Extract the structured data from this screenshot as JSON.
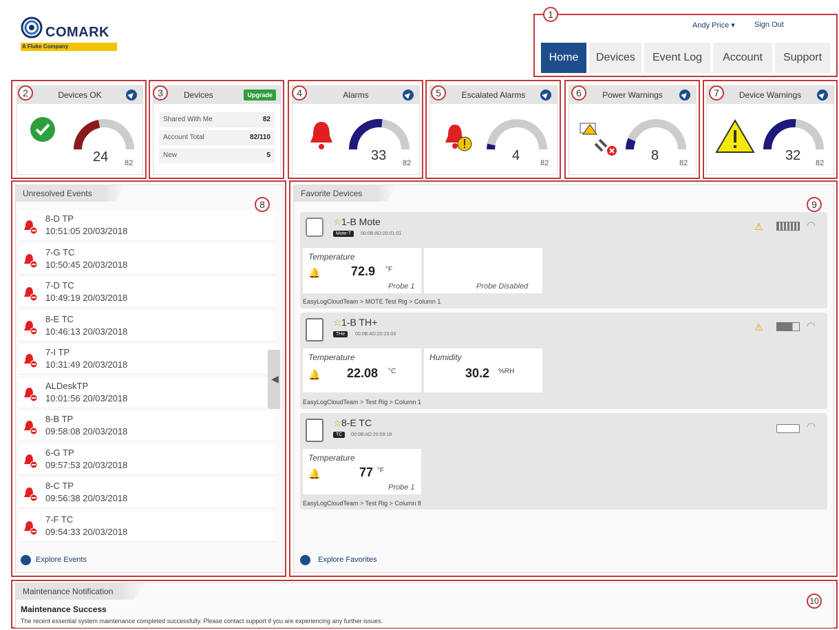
{
  "brand": {
    "name": "COMARK",
    "tagline": "A Fluke Company",
    "color": "#1d2f63",
    "accent": "#f3c300"
  },
  "user": {
    "name": "Andy Price",
    "sign_out": "Sign Out"
  },
  "nav": [
    "Home",
    "Devices",
    "Event Log",
    "Account",
    "Support"
  ],
  "annotations": [
    "1",
    "2",
    "3",
    "4",
    "5",
    "6",
    "7",
    "8",
    "9",
    "10"
  ],
  "cards": {
    "devices_ok": {
      "title": "Devices OK",
      "value": "24",
      "max": "82"
    },
    "devices": {
      "title": "Devices",
      "upgrade": "Upgrade",
      "rows": [
        {
          "label": "Shared With Me",
          "value": "82"
        },
        {
          "label": "Account Total",
          "value": "82/110"
        },
        {
          "label": "New",
          "value": "5"
        }
      ]
    },
    "alarms": {
      "title": "Alarms",
      "value": "33",
      "max": "82"
    },
    "escalated": {
      "title": "Escalated Alarms",
      "value": "4",
      "max": "82"
    },
    "power": {
      "title": "Power Warnings",
      "value": "8",
      "max": "82"
    },
    "device_warn": {
      "title": "Device Warnings",
      "value": "32",
      "max": "82"
    }
  },
  "events": {
    "title": "Unresolved Events",
    "explore": "Explore Events",
    "items": [
      {
        "name": "8-D TP",
        "time": "10:51:05  20/03/2018"
      },
      {
        "name": "7-G TC",
        "time": "10:50:45  20/03/2018"
      },
      {
        "name": "7-D TC",
        "time": "10:49:19  20/03/2018"
      },
      {
        "name": "8-E TC",
        "time": "10:46:13  20/03/2018"
      },
      {
        "name": "7-I TP",
        "time": "10:31:49  20/03/2018"
      },
      {
        "name": "ALDeskTP",
        "time": "10:01:56  20/03/2018"
      },
      {
        "name": "8-B TP",
        "time": "09:58:08  20/03/2018"
      },
      {
        "name": "6-G TP",
        "time": "09:57:53  20/03/2018"
      },
      {
        "name": "8-C TP",
        "time": "09:56:38  20/03/2018"
      },
      {
        "name": "7-F TC",
        "time": "09:54:33  20/03/2018"
      }
    ]
  },
  "favorites": {
    "title": "Favorite Devices",
    "explore": "Explore Favorites",
    "devices": [
      {
        "name": "1-B Mote",
        "tag": "Mote-T",
        "mac": "00:0B:AD:20:01:01",
        "r1_label": "Temperature",
        "r1_value": "72.9",
        "r1_unit": "°F",
        "r1_probe": "Probe 1",
        "r2_probe": "Probe Disabled",
        "path": "EasyLogCloudTeam > MOTE Test Rig > Column 1"
      },
      {
        "name": "1-B TH+",
        "tag": "THe",
        "mac": "00:0B:AD:20:23:03",
        "r1_label": "Temperature",
        "r1_value": "22.08",
        "r1_unit": "°C",
        "r2_label": "Humidity",
        "r2_value": "30.2",
        "r2_unit": "%RH",
        "path": "EasyLogCloudTeam > Test Rig > Column 1"
      },
      {
        "name": "8-E TC",
        "tag": "TC",
        "mac": "00:0B:AD:20:59:18",
        "r1_label": "Temperature",
        "r1_value": "77",
        "r1_unit": "°F",
        "r1_probe": "Probe 1",
        "path": "EasyLogCloudTeam > Test Rig > Column 8"
      }
    ]
  },
  "maintenance": {
    "title": "Maintenance Notification",
    "heading": "Maintenance Success",
    "text": "The recent essential system maintenance completed successfully. Please contact support if you are experiencing any further issues."
  },
  "colors": {
    "nav_active": "#1e4d8c",
    "alarm": "#e02020",
    "gauge_blue": "#1e1a7a",
    "gauge_dark_red": "#8b1a1a",
    "ok_green": "#2e9e3f"
  }
}
